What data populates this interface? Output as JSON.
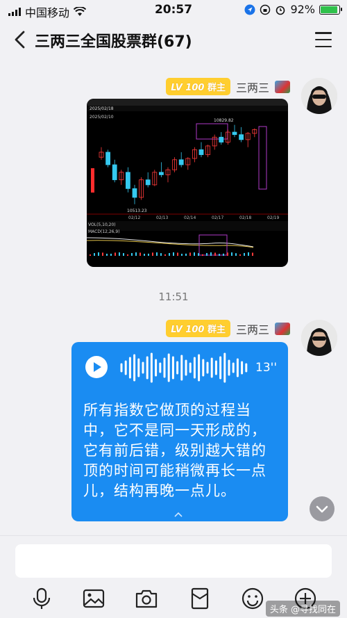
{
  "status_bar": {
    "carrier": "中国移动",
    "time": "20:57",
    "battery": "92%",
    "battery_level": 0.92
  },
  "header": {
    "title": "三两三全国股票群(67)"
  },
  "messages": [
    {
      "badge_prefix": "LV",
      "badge_level": "100",
      "badge_role": "群主",
      "sender": "三两三",
      "type": "image"
    },
    {
      "badge_prefix": "LV",
      "badge_level": "100",
      "badge_role": "群主",
      "sender": "三两三",
      "type": "voice",
      "duration": "13''",
      "transcript": "所有指数它做顶的过程当中，它不是同一天形成的，它有前后错，级别越大错的顶的时间可能稍微再长一点儿，结构再晚一点儿。"
    }
  ],
  "timestamp": "11:51",
  "chart_image": {
    "date_label": "2025/02/18",
    "high_label": "10829.82",
    "low_label": "10513.23",
    "start_date": "2025/02/10",
    "x_ticks": [
      "02/12",
      "02/13",
      "02/14",
      "02/17",
      "02/18",
      "02/19"
    ],
    "vol_label": "VOL(5,10,20)",
    "macd_label": "MACD(12,26,9)",
    "candles": [
      [
        10700,
        10740,
        10690,
        10720
      ],
      [
        10720,
        10730,
        10660,
        10670
      ],
      [
        10670,
        10690,
        10600,
        10610
      ],
      [
        10610,
        10650,
        10590,
        10640
      ],
      [
        10640,
        10660,
        10560,
        10575
      ],
      [
        10575,
        10590,
        10513,
        10540
      ],
      [
        10540,
        10620,
        10530,
        10610
      ],
      [
        10610,
        10640,
        10580,
        10590
      ],
      [
        10590,
        10650,
        10585,
        10640
      ],
      [
        10640,
        10680,
        10620,
        10630
      ],
      [
        10630,
        10660,
        10600,
        10650
      ],
      [
        10650,
        10700,
        10640,
        10690
      ],
      [
        10690,
        10720,
        10660,
        10670
      ],
      [
        10670,
        10700,
        10650,
        10695
      ],
      [
        10695,
        10740,
        10680,
        10730
      ],
      [
        10730,
        10760,
        10700,
        10710
      ],
      [
        10710,
        10750,
        10700,
        10745
      ],
      [
        10745,
        10790,
        10730,
        10780
      ],
      [
        10780,
        10800,
        10750,
        10760
      ],
      [
        10760,
        10810,
        10750,
        10800
      ],
      [
        10800,
        10829,
        10780,
        10790
      ],
      [
        10790,
        10820,
        10760,
        10770
      ],
      [
        10770,
        10800,
        10740,
        10795
      ],
      [
        10795,
        10815,
        10780,
        10810
      ]
    ]
  },
  "toolbar": {
    "items": [
      "microphone-icon",
      "image-icon",
      "camera-icon",
      "red-packet-icon",
      "emoji-icon",
      "plus-icon"
    ]
  },
  "watermark": "头条 @寻找同在"
}
